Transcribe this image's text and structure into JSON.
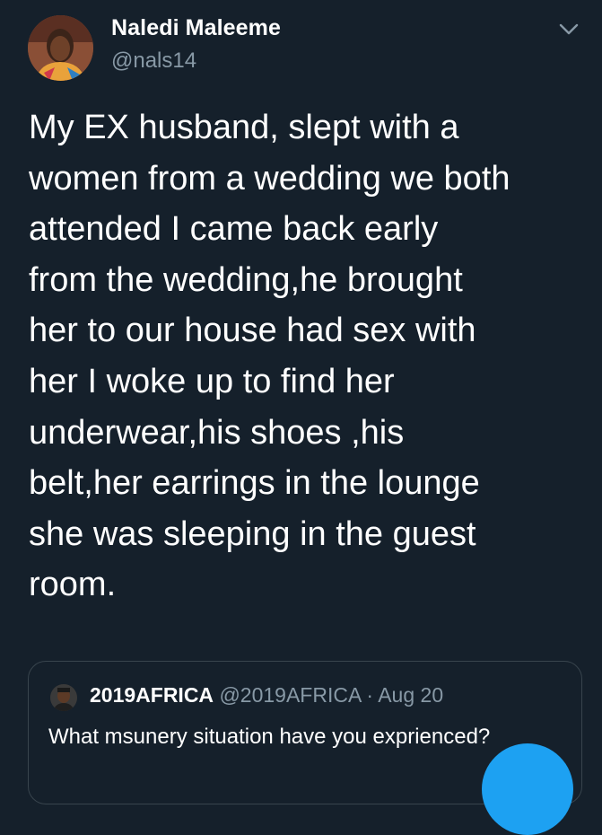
{
  "tweet": {
    "display_name": "Naledi Maleeme",
    "handle": "@nals14",
    "text": "My EX husband, slept with a\nwomen from a wedding we both\nattended I came back early\nfrom the wedding,he brought\nher to our house had sex with\nher I woke up to find her\nunderwear,his shoes ,his\nbelt,her earrings in the lounge\nshe was sleeping in the guest\nroom.",
    "menu_icon": "chevron-down-icon"
  },
  "quoted_tweet": {
    "display_name": "2019AFRICA",
    "handle": "@2019AFRICA",
    "separator": "·",
    "date": "Aug 20",
    "text": "What msunery situation have you exprienced?"
  },
  "compose_button": {
    "icon": "compose-icon"
  },
  "colors": {
    "background": "#15202b",
    "primary_text": "#ffffff",
    "secondary_text": "#8899a6",
    "border": "#38444d",
    "accent": "#1da1f2"
  }
}
